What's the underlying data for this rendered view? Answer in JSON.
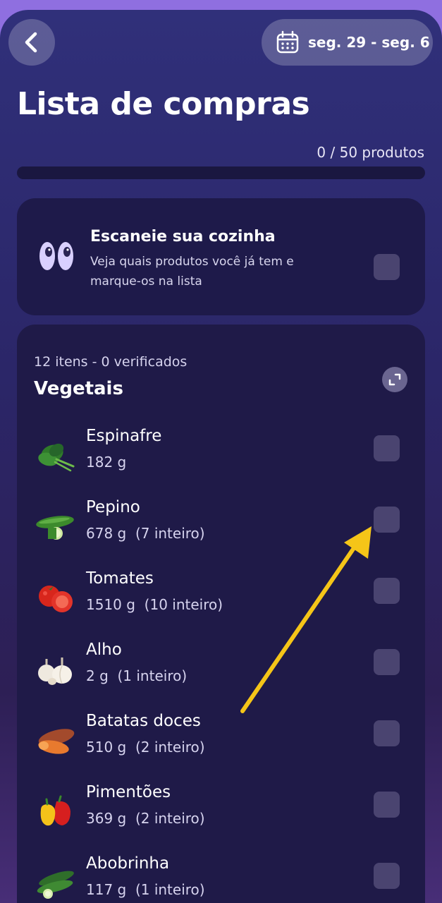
{
  "header": {
    "date_range": "seg. 29 - seg. 6",
    "title": "Lista de compras",
    "product_count": "0 / 50 produtos",
    "progress_fraction": 0
  },
  "scan_card": {
    "title": "Escaneie sua cozinha",
    "description": "Veja quais produtos você já tem e marque-os na lista",
    "checked": false
  },
  "section": {
    "meta": "12 itens - 0 verificados",
    "title": "Vegetais",
    "items": [
      {
        "name": "Espinafre",
        "qty": "182 g",
        "icon": "spinach-icon",
        "checked": false
      },
      {
        "name": "Pepino",
        "qty": "678 g  (7 inteiro)",
        "icon": "cucumber-icon",
        "checked": false
      },
      {
        "name": "Tomates",
        "qty": "1510 g  (10 inteiro)",
        "icon": "tomato-icon",
        "checked": false
      },
      {
        "name": "Alho",
        "qty": "2 g  (1 inteiro)",
        "icon": "garlic-icon",
        "checked": false
      },
      {
        "name": "Batatas doces",
        "qty": "510 g  (2 inteiro)",
        "icon": "sweet-potato-icon",
        "checked": false
      },
      {
        "name": "Pimentões",
        "qty": "369 g  (2 inteiro)",
        "icon": "bell-pepper-icon",
        "checked": false
      },
      {
        "name": "Abobrinha",
        "qty": "117 g  (1 inteiro)",
        "icon": "zucchini-icon",
        "checked": false
      }
    ]
  },
  "colors": {
    "accent": "#a990ff",
    "annotation_arrow": "#f5c518"
  }
}
